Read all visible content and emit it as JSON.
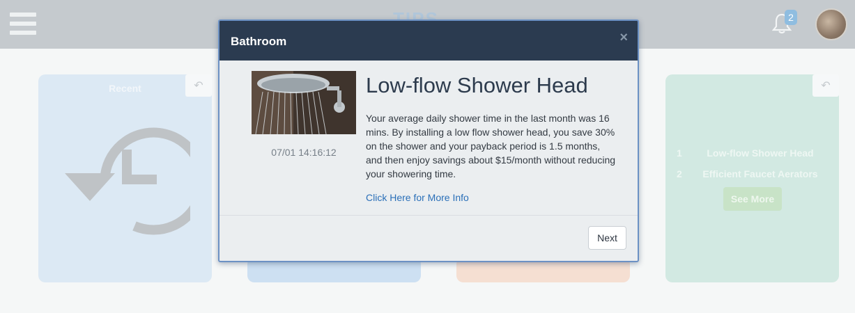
{
  "header": {
    "logo_text": "TIPS",
    "notification_count": "2"
  },
  "cards": {
    "recent": {
      "title": "Recent"
    },
    "tips": {
      "items": [
        {
          "number": "1",
          "label": "Low-flow Shower Head"
        },
        {
          "number": "2",
          "label": "Efficient Faucet Aerators"
        }
      ],
      "see_more_label": "See More"
    }
  },
  "modal": {
    "title": "Bathroom",
    "close_symbol": "×",
    "timestamp": "07/01 14:16:12",
    "heading": "Low-flow Shower Head",
    "body": "Your average daily shower time in the last month was 16 mins. By installing a low flow shower head, you save 30% on the shower and your payback period is 1.5 months, and then enjoy savings about $15/month without reducing your showering time.",
    "link_label": "Click Here for More Info",
    "next_label": "Next"
  },
  "colors": {
    "header_bg": "#c5cace",
    "modal_header_bg": "#2b3b50",
    "link": "#2a6fb8"
  },
  "icons": [
    "menu-icon",
    "bell-icon",
    "undo-icon",
    "history-icon",
    "close-icon"
  ]
}
